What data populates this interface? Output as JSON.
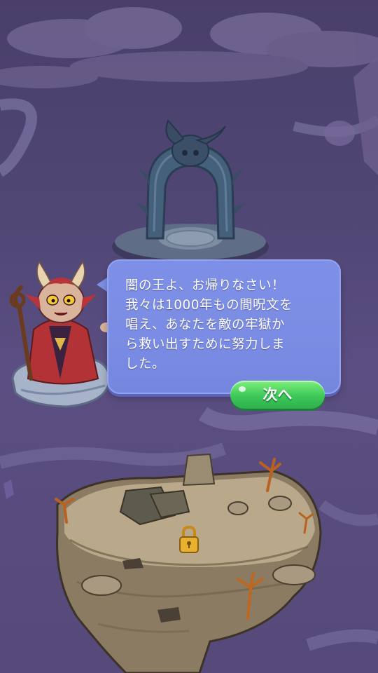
{
  "dialog": {
    "speaker": "demon-advisor",
    "text": "闇の王よ、お帰りなさい！\n我々は1000年もの間呪文を\n唱え、あなたを敵の牢獄か\nら救い出すために努力しま\nした。"
  },
  "buttons": {
    "next_label": "次へ"
  },
  "map": {
    "locked_node_icon": "padlock-icon",
    "portal_icon": "stone-horned-portal"
  },
  "colors": {
    "bubble": "#7d8fe6",
    "button_green": "#3ec85a",
    "sky_purple": "#4f4674",
    "lock_gold": "#e8b230"
  }
}
